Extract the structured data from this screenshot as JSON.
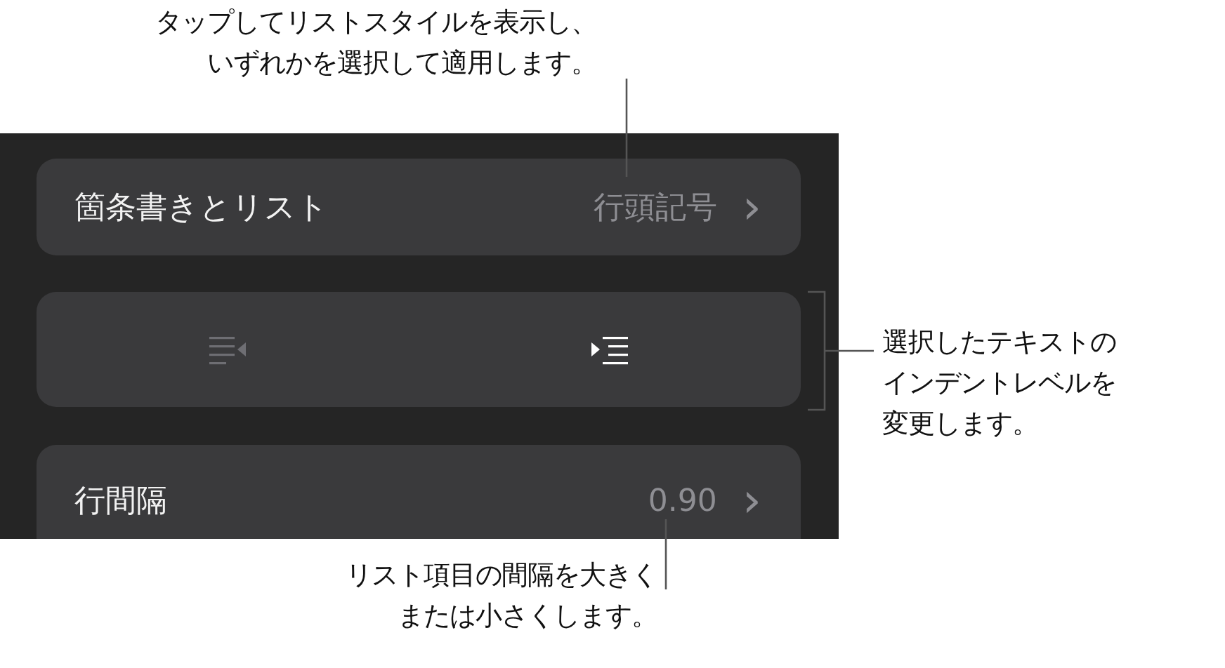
{
  "panel": {
    "rows": [
      {
        "kind": "nav",
        "label": "箇条書きとリスト",
        "value": "行頭記号",
        "chevron": "›"
      },
      {
        "kind": "indent",
        "buttons": [
          {
            "kind": "outdent",
            "disabled": true
          },
          {
            "kind": "indent",
            "disabled": false
          }
        ]
      },
      {
        "kind": "nav",
        "label": "行間隔",
        "value": "0.90",
        "chevron": "›"
      }
    ]
  },
  "callouts": [
    {
      "kind": "top",
      "lines": [
        "タップしてリストスタイルを表示し、",
        "いずれかを選択して適用します。"
      ]
    },
    {
      "kind": "right",
      "lines": [
        "選択したテキストの",
        "インデントレベルを",
        "変更します。"
      ]
    },
    {
      "kind": "bottom",
      "lines": [
        "リスト項目の間隔を大きく",
        "または小さくします。"
      ]
    }
  ]
}
